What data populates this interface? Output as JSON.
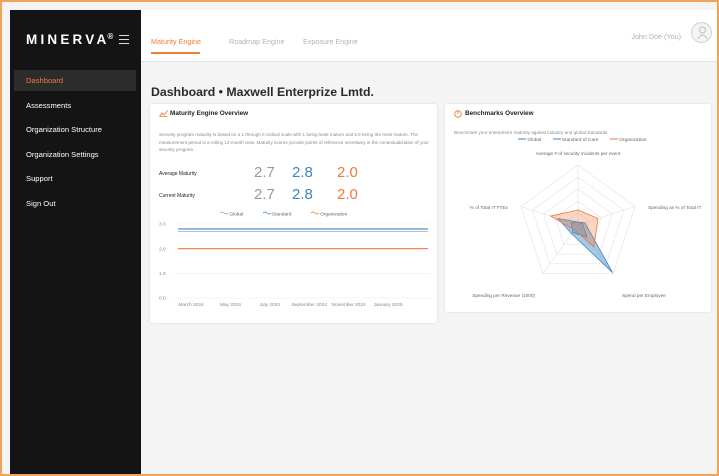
{
  "app": {
    "logo": "MINERVA",
    "logo_mark": "®"
  },
  "sidebar": {
    "items": [
      {
        "label": "Dashboard",
        "active": true
      },
      {
        "label": "Assessments",
        "active": false
      },
      {
        "label": "Organization Structure",
        "active": false
      },
      {
        "label": "Organization Settings",
        "active": false
      },
      {
        "label": "Support",
        "active": false
      },
      {
        "label": "Sign Out",
        "active": false
      }
    ]
  },
  "header": {
    "tabs": [
      {
        "label": "Maturity Engine",
        "active": true
      },
      {
        "label": "Roadmap Engine",
        "active": false
      },
      {
        "label": "Exposure Engine",
        "active": false
      }
    ],
    "user_name": "John Doe (You)"
  },
  "page": {
    "title": "Dashboard • Maxwell Enterprize Lmtd."
  },
  "maturity_card": {
    "title": "Maturity Engine Overview",
    "description": "Security program maturity is based on a 1 through 6 ordinal scale with 1 being least mature and 5.9 being the most mature. The measurement period is a rolling 12-month view. Maturity scores provide points of reference necessary in the contextualization of your security program.",
    "average_label": "Average Maturity",
    "average_values": [
      "2.7",
      "2.8",
      "2.0"
    ],
    "current_label": "Current Maturity",
    "current_values": [
      "2.7",
      "2.8",
      "2.0"
    ],
    "legend": [
      "Global",
      "Standard",
      "Organization"
    ],
    "colors": {
      "global": "#9a9a9a",
      "standard": "#3d86c9",
      "organization": "#ef7a3a"
    }
  },
  "benchmarks_card": {
    "title": "Benchmarks Overview",
    "description": "Benchmark your enterprise's maturity against industry and global standards.",
    "legend": [
      "Global",
      "Standard of Care",
      "Organization"
    ]
  },
  "chart_data": [
    {
      "type": "line",
      "x": [
        "March 2024",
        "May 2024",
        "July 2024",
        "September 2024",
        "November 2024",
        "January 2025"
      ],
      "ylim": [
        0,
        3
      ],
      "yticks": [
        "0.0",
        "1.0",
        "2.0",
        "3.0"
      ],
      "series": [
        {
          "name": "Global",
          "values": [
            2.7,
            2.7,
            2.7,
            2.7,
            2.7,
            2.7
          ]
        },
        {
          "name": "Standard",
          "values": [
            2.8,
            2.8,
            2.8,
            2.8,
            2.8,
            2.8
          ]
        },
        {
          "name": "Organization",
          "values": [
            2.0,
            2.0,
            2.0,
            2.0,
            2.0,
            2.0
          ]
        }
      ],
      "grid": true,
      "legend_position": "top"
    },
    {
      "type": "radar",
      "axes": [
        "Average # of security incidents per event",
        "Spending as % of Total IT",
        "Spend per Employee",
        "Spending per Revenue (1000)",
        "% of Total IT FTEs"
      ],
      "series": [
        {
          "name": "Global",
          "values": [
            0.05,
            0.08,
            0.25,
            0.15,
            0.12
          ]
        },
        {
          "name": "Standard of Care",
          "values": [
            0.05,
            0.12,
            0.98,
            0.18,
            0.35
          ]
        },
        {
          "name": "Organization",
          "values": [
            0.25,
            0.35,
            0.45,
            0.1,
            0.48
          ]
        }
      ],
      "grid": true,
      "legend_position": "top"
    }
  ]
}
